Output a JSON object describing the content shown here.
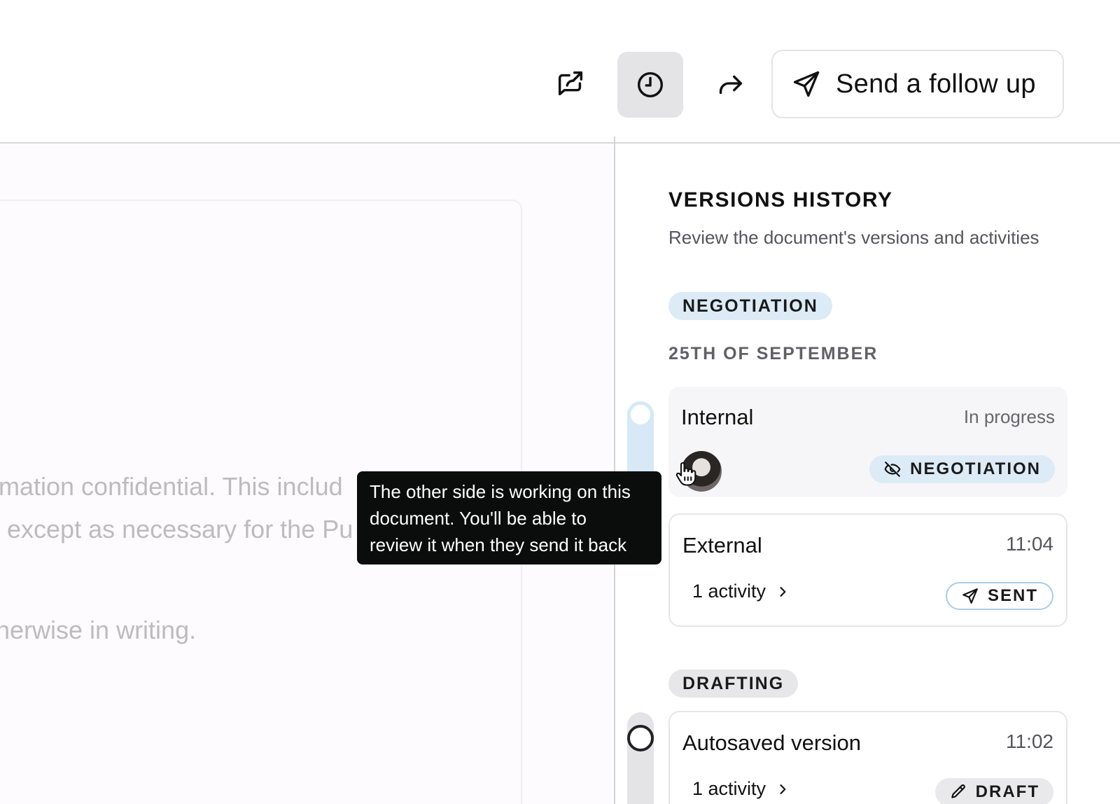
{
  "toolbar": {
    "share_icon": "share-icon",
    "history_icon": "clock-icon",
    "forward_icon": "forward-arrow-icon",
    "follow_up_label": "Send a follow up",
    "follow_up_icon": "send-icon"
  },
  "document": {
    "lines": [
      "mation confidential. This includ",
      "except as necessary for the Pu",
      "nerwise in writing."
    ]
  },
  "tooltip": {
    "lines": [
      "The other side is working on this",
      "document. You'll be able to",
      "review it when they send it back"
    ]
  },
  "versions": {
    "title": "VERSIONS HISTORY",
    "subtitle": "Review the document's versions and activities",
    "groups": [
      {
        "stage": "NEGOTIATION",
        "date": "25TH OF SEPTEMBER",
        "items": [
          {
            "title": "Internal",
            "status": "In progress",
            "badge": "NEGOTIATION",
            "badge_icon": "eye-off-icon"
          },
          {
            "title": "External",
            "time": "11:04",
            "activity": "1 activity",
            "badge": "SENT",
            "badge_icon": "send-icon"
          }
        ]
      },
      {
        "stage": "DRAFTING",
        "items": [
          {
            "title": "Autosaved version",
            "time": "11:02",
            "activity": "1 activity",
            "badge": "DRAFT",
            "badge_icon": "pencil-icon"
          }
        ]
      }
    ]
  },
  "colors": {
    "negotiation_bg": "#dcebf6",
    "drafting_bg": "#e7e7ea",
    "tooltip_bg": "#0b0c0c",
    "active_tool_bg": "#e4e4e7"
  }
}
